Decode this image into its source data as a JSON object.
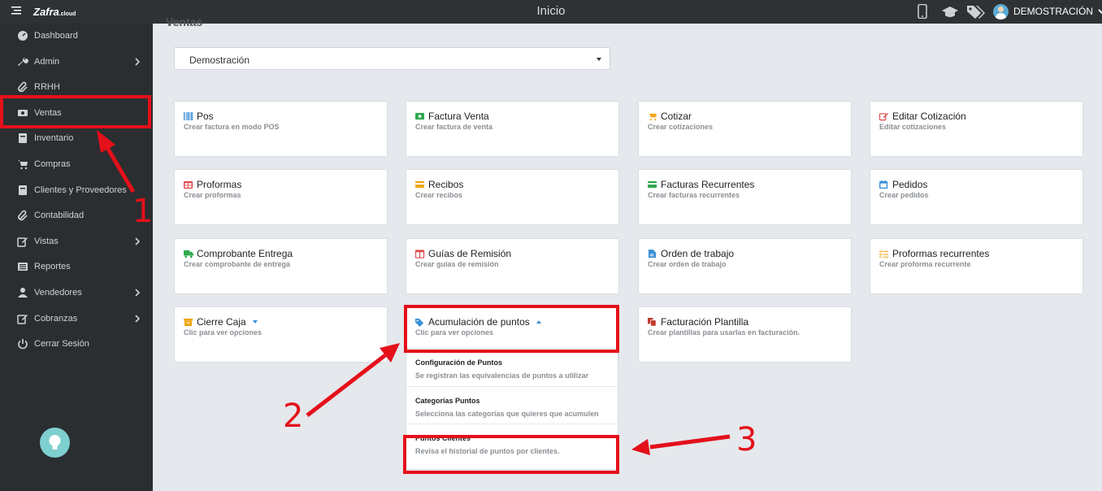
{
  "header": {
    "app_name": "Zafra",
    "app_suffix": ".cloud",
    "page_title": "Inicio",
    "user_name": "DEMOSTRACIÓN"
  },
  "sidebar": {
    "items": [
      {
        "label": "Dashboard",
        "icon": "dashboard-icon",
        "has_submenu": false
      },
      {
        "label": "Admin",
        "icon": "wrench-icon",
        "has_submenu": true
      },
      {
        "label": "RRHH",
        "icon": "paperclip-icon",
        "has_submenu": false
      },
      {
        "label": "Ventas",
        "icon": "money-icon",
        "has_submenu": false
      },
      {
        "label": "Inventario",
        "icon": "book-icon",
        "has_submenu": false
      },
      {
        "label": "Compras",
        "icon": "cart-icon",
        "has_submenu": false
      },
      {
        "label": "Clientes y Proveedores",
        "icon": "book-icon",
        "has_submenu": false
      },
      {
        "label": "Contabilidad",
        "icon": "paperclip-icon",
        "has_submenu": false
      },
      {
        "label": "Vistas",
        "icon": "edit-icon",
        "has_submenu": true
      },
      {
        "label": "Reportes",
        "icon": "list-icon",
        "has_submenu": false
      },
      {
        "label": "Vendedores",
        "icon": "user-icon",
        "has_submenu": true
      },
      {
        "label": "Cobranzas",
        "icon": "edit-icon",
        "has_submenu": true
      },
      {
        "label": "Cerrar Sesión",
        "icon": "power-icon",
        "has_submenu": false
      }
    ]
  },
  "main": {
    "section_title": "Ventas",
    "company_select": "Demostración",
    "cards": [
      {
        "title": "Pos",
        "subtitle": "Crear factura en modo POS",
        "icon": "barcode-icon",
        "color": "#3b8fd6"
      },
      {
        "title": "Factura Venta",
        "subtitle": "Crear factura de venta",
        "icon": "money-icon",
        "color": "#2fa84f"
      },
      {
        "title": "Cotizar",
        "subtitle": "Crear cotizaciones",
        "icon": "cart-icon",
        "color": "#f0a818"
      },
      {
        "title": "Editar Cotización",
        "subtitle": "Editar cotizaciones",
        "icon": "edit-icon",
        "color": "#e04a4a"
      },
      {
        "title": "Proformas",
        "subtitle": "Crear proformas",
        "icon": "table-icon",
        "color": "#e04a4a"
      },
      {
        "title": "Recibos",
        "subtitle": "Crear recibos",
        "icon": "card-icon",
        "color": "#f0a818"
      },
      {
        "title": "Facturas Recurrentes",
        "subtitle": "Crear facturas recurrentes",
        "icon": "card-icon",
        "color": "#2fa84f"
      },
      {
        "title": "Pedidos",
        "subtitle": "Crear pedidos",
        "icon": "calendar-icon",
        "color": "#3b8fd6"
      },
      {
        "title": "Comprobante Entrega",
        "subtitle": "Crear comprobante de entrega",
        "icon": "truck-icon",
        "color": "#2fa84f"
      },
      {
        "title": "Guías de Remisión",
        "subtitle": "Crear guías de remisión",
        "icon": "columns-icon",
        "color": "#e04a4a"
      },
      {
        "title": "Orden de trabajo",
        "subtitle": "Crear orden de trabajo",
        "icon": "file-icon",
        "color": "#3b8fd6"
      },
      {
        "title": "Proformas recurrentes",
        "subtitle": "Crear proforma recurrente",
        "icon": "tasks-icon",
        "color": "#f0a818"
      },
      {
        "title": "Cierre Caja",
        "subtitle": "Clic para ver opciones",
        "icon": "archive-icon",
        "color": "#f0a818",
        "dropdown": "down"
      },
      {
        "title": "Acumulación de puntos",
        "subtitle": "Clic para ver opciones",
        "icon": "tag-icon",
        "color": "#3b8fd6",
        "dropdown": "up"
      },
      {
        "title": "Facturación Plantilla",
        "subtitle": "Crear plantillas para usarlas en facturación.",
        "icon": "copy-icon",
        "color": "#c0392b"
      }
    ],
    "points_submenu": [
      {
        "title": "Configuración de Puntos",
        "subtitle": "Se registran las equivalencias de puntos a utilizar"
      },
      {
        "title": "Categorías Puntos",
        "subtitle": "Selecciona las categorías que quieres que acumulen"
      },
      {
        "title": "Puntos Clientes",
        "subtitle": "Revisa el historial de puntos por clientes."
      }
    ]
  },
  "annotations": {
    "color": "#e4101a",
    "labels": [
      "1",
      "2",
      "3"
    ]
  }
}
